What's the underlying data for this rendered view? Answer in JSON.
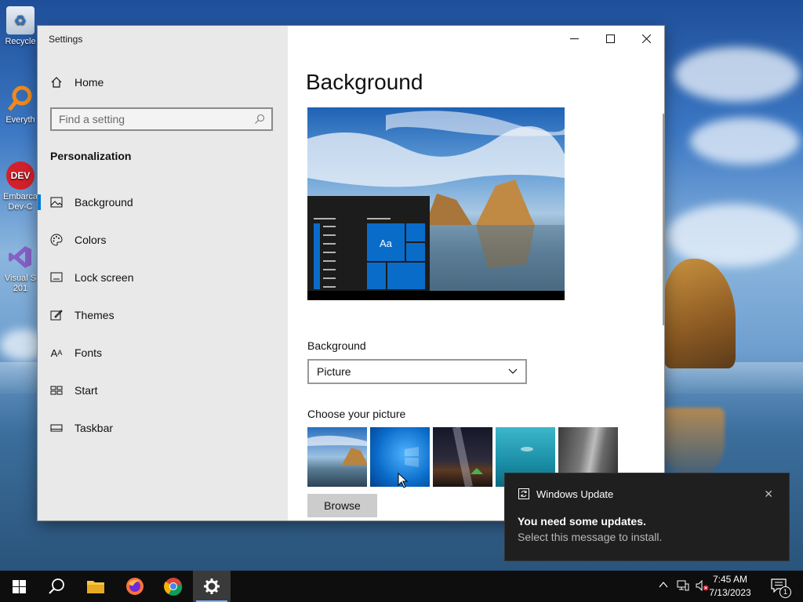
{
  "desktop": {
    "icons": [
      {
        "name": "recycle-bin",
        "label": "Recycle"
      },
      {
        "name": "everything",
        "label": "Everyth"
      },
      {
        "name": "embarcadero-dev-cpp",
        "label": "Embarca\nDev-C"
      },
      {
        "name": "visual-studio",
        "label": "Visual S\n201"
      }
    ]
  },
  "window": {
    "title": "Settings",
    "controls": {
      "minimize": "—",
      "maximize": "☐",
      "close": "✕"
    }
  },
  "sidebar": {
    "home_label": "Home",
    "search_placeholder": "Find a setting",
    "category": "Personalization",
    "items": [
      {
        "label": "Background",
        "icon": "picture-icon",
        "selected": true
      },
      {
        "label": "Colors",
        "icon": "palette-icon",
        "selected": false
      },
      {
        "label": "Lock screen",
        "icon": "lock-screen-icon",
        "selected": false
      },
      {
        "label": "Themes",
        "icon": "themes-icon",
        "selected": false
      },
      {
        "label": "Fonts",
        "icon": "fonts-icon",
        "selected": false
      },
      {
        "label": "Start",
        "icon": "start-icon",
        "selected": false
      },
      {
        "label": "Taskbar",
        "icon": "taskbar-icon",
        "selected": false
      }
    ]
  },
  "main": {
    "heading": "Background",
    "preview_tile_text": "Aa",
    "background_label": "Background",
    "background_value": "Picture",
    "choose_label": "Choose your picture",
    "browse_label": "Browse"
  },
  "toast": {
    "app_name": "Windows Update",
    "title": "You need some updates.",
    "body": "Select this message to install.",
    "close": "✕"
  },
  "taskbar": {
    "time": "7:45 AM",
    "date": "7/13/2023",
    "notification_count": "1",
    "apps": [
      "start",
      "search",
      "file-explorer",
      "firefox",
      "chrome",
      "settings"
    ],
    "active_app": "settings"
  },
  "colors": {
    "accent": "#0078d7",
    "sidebar_bg": "#e9e9e9",
    "taskbar_bg": "#0e0e0e",
    "toast_bg": "#1f1f1f"
  }
}
